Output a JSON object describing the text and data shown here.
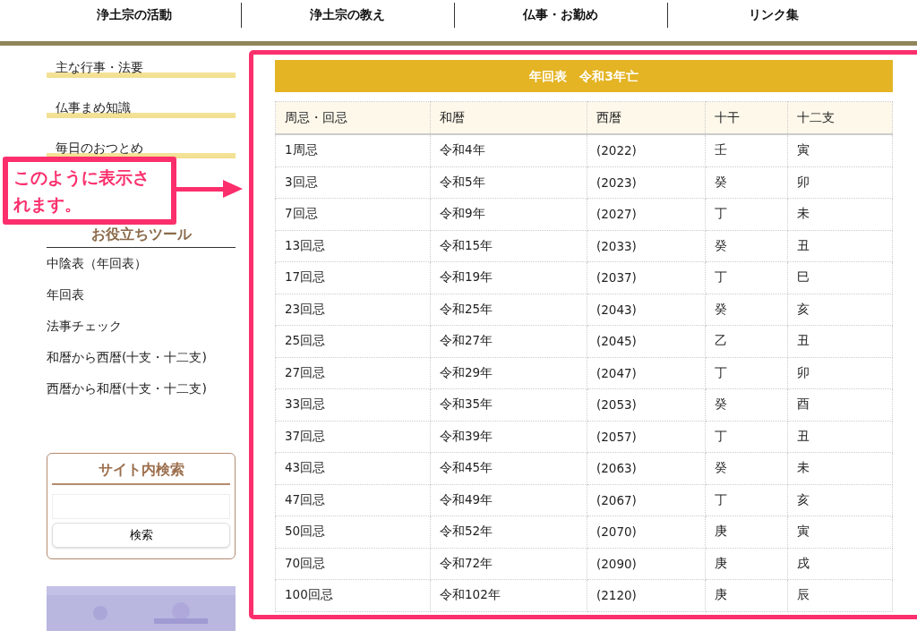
{
  "nav": [
    {
      "label": "浄土宗の活動"
    },
    {
      "label": "浄土宗の教え"
    },
    {
      "label": "仏事・お勤め"
    },
    {
      "label": "リンク集"
    }
  ],
  "sidebar": {
    "menu": [
      {
        "label": "主な行事・法要"
      },
      {
        "label": "仏事まめ知識"
      },
      {
        "label": "毎日のおつとめ"
      }
    ],
    "tools_heading": "お役立ちツール",
    "tools": [
      {
        "label": "中陰表（年回表）"
      },
      {
        "label": "年回表"
      },
      {
        "label": "法事チェック"
      },
      {
        "label": "和暦から西暦(十支・十二支)"
      },
      {
        "label": "西暦から和暦(十支・十二支)"
      }
    ],
    "search": {
      "title": "サイト内検索",
      "button": "検索"
    }
  },
  "table": {
    "caption": "年回表　令和3年亡",
    "columns": [
      "周忌・回忌",
      "和暦",
      "西暦",
      "十干",
      "十二支"
    ],
    "rows": [
      [
        "1周忌",
        "令和4年",
        "(2022)",
        "壬",
        "寅"
      ],
      [
        "3回忌",
        "令和5年",
        "(2023)",
        "癸",
        "卯"
      ],
      [
        "7回忌",
        "令和9年",
        "(2027)",
        "丁",
        "未"
      ],
      [
        "13回忌",
        "令和15年",
        "(2033)",
        "癸",
        "丑"
      ],
      [
        "17回忌",
        "令和19年",
        "(2037)",
        "丁",
        "巳"
      ],
      [
        "23回忌",
        "令和25年",
        "(2043)",
        "癸",
        "亥"
      ],
      [
        "25回忌",
        "令和27年",
        "(2045)",
        "乙",
        "丑"
      ],
      [
        "27回忌",
        "令和29年",
        "(2047)",
        "丁",
        "卯"
      ],
      [
        "33回忌",
        "令和35年",
        "(2053)",
        "癸",
        "酉"
      ],
      [
        "37回忌",
        "令和39年",
        "(2057)",
        "丁",
        "丑"
      ],
      [
        "43回忌",
        "令和45年",
        "(2063)",
        "癸",
        "未"
      ],
      [
        "47回忌",
        "令和49年",
        "(2067)",
        "丁",
        "亥"
      ],
      [
        "50回忌",
        "令和52年",
        "(2070)",
        "庚",
        "寅"
      ],
      [
        "70回忌",
        "令和72年",
        "(2090)",
        "庚",
        "戌"
      ],
      [
        "100回忌",
        "令和102年",
        "(2120)",
        "庚",
        "辰"
      ]
    ]
  },
  "annotation": {
    "text": "このように表示されます。"
  }
}
